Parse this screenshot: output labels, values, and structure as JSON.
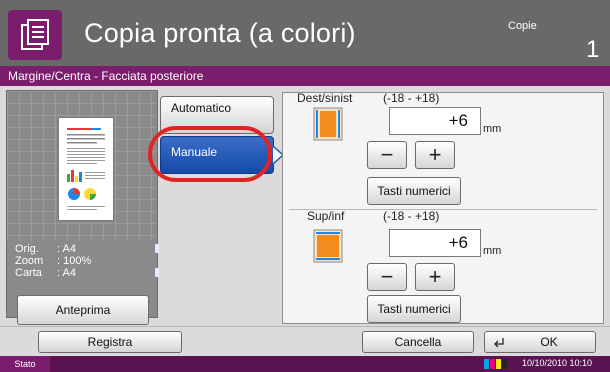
{
  "header": {
    "title": "Copia pronta (a colori)",
    "copies_label": "Copie",
    "copies_count": "1"
  },
  "section": {
    "title": "Margine/Centra - Facciata posteriore"
  },
  "preview": {
    "rows": [
      {
        "key": "Orig.",
        "value": ": A4"
      },
      {
        "key": "Zoom",
        "value": ": 100%"
      },
      {
        "key": "Carta",
        "value": ": A4"
      }
    ],
    "preview_button": "Anteprima"
  },
  "modes": {
    "auto_label": "Automatico",
    "manual_label": "Manuale",
    "selected": "Manuale"
  },
  "horizontal": {
    "label": "Dest/sinist",
    "range": "(-18 - +18)",
    "value": "+6",
    "unit": "mm",
    "minus": "−",
    "plus": "+",
    "numkeys_label": "Tasti numerici"
  },
  "vertical": {
    "label": "Sup/inf",
    "range": "(-18 - +18)",
    "value": "+6",
    "unit": "mm",
    "minus": "−",
    "plus": "+",
    "numkeys_label": "Tasti numerici"
  },
  "bottom": {
    "register_label": "Registra",
    "cancel_label": "Cancella",
    "ok_label": "OK"
  },
  "status": {
    "label": "Stato",
    "datetime": "10/10/2010  10:10"
  },
  "colors": {
    "accent": "#7a1d6c",
    "selected_button": "#1f56b5",
    "highlight_ring": "#e02424",
    "header_bg": "#6a6868"
  }
}
